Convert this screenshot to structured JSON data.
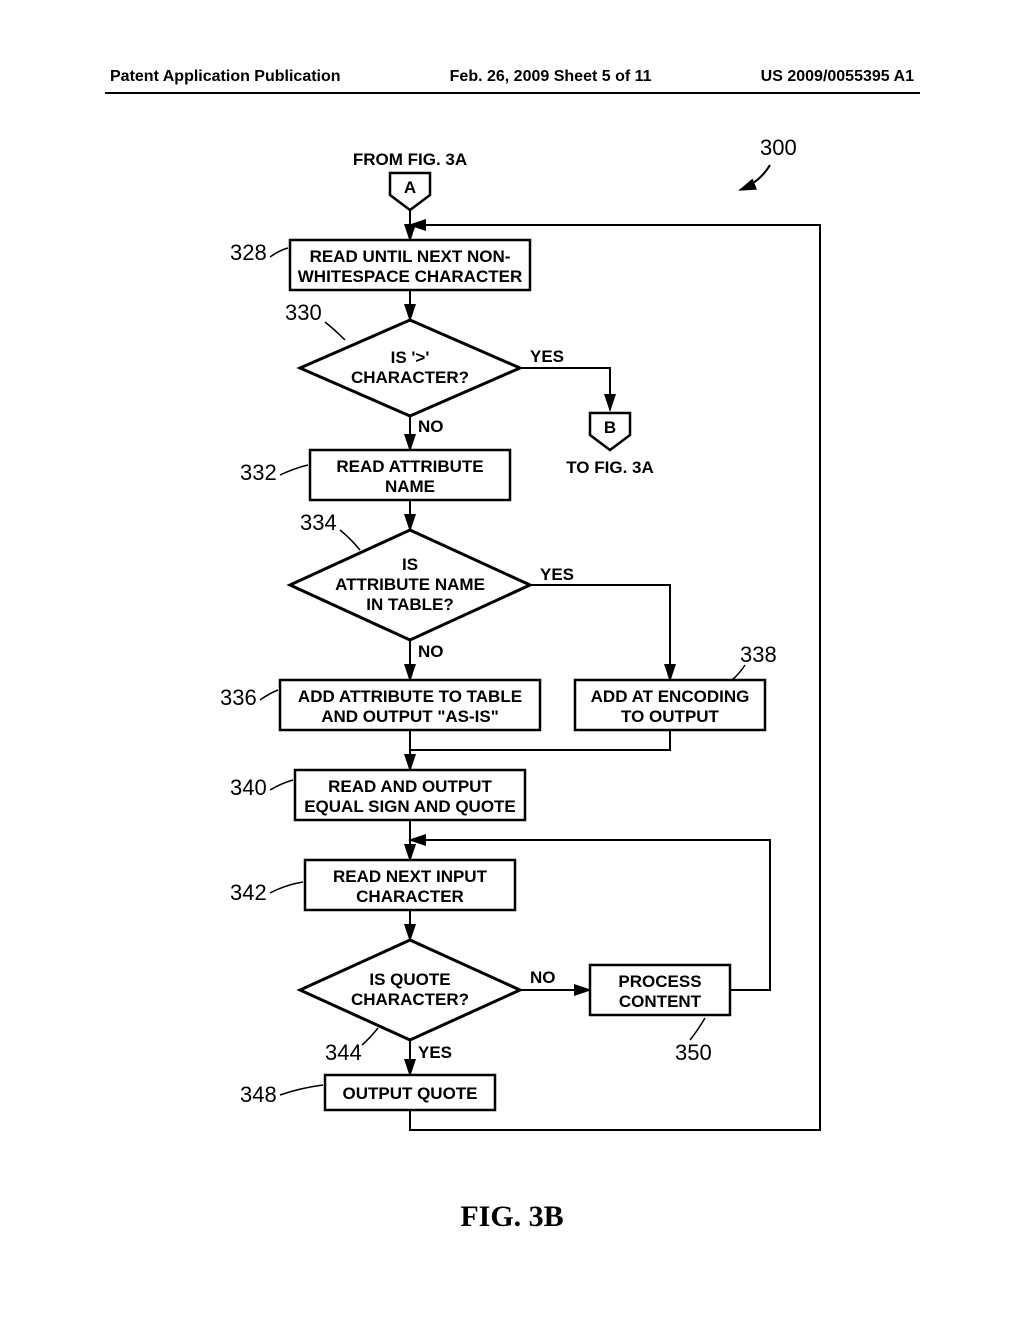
{
  "header": {
    "left": "Patent Application Publication",
    "center": "Feb. 26, 2009 Sheet 5 of 11",
    "right": "US 2009/0055395 A1"
  },
  "figure": {
    "title": "FIG. 3B",
    "overall_ref": "300",
    "from_label": "FROM FIG. 3A",
    "to_label": "TO FIG. 3A",
    "connector_a": "A",
    "connector_b": "B",
    "yes": "YES",
    "no": "NO",
    "steps": {
      "s328": {
        "ref": "328",
        "text1": "READ UNTIL NEXT NON-",
        "text2": "WHITESPACE CHARACTER"
      },
      "s330": {
        "ref": "330",
        "text1": "IS '>'",
        "text2": "CHARACTER?"
      },
      "s332": {
        "ref": "332",
        "text1": "READ ATTRIBUTE",
        "text2": "NAME"
      },
      "s334": {
        "ref": "334",
        "text1": "IS",
        "text2": "ATTRIBUTE NAME",
        "text3": "IN TABLE?"
      },
      "s336": {
        "ref": "336",
        "text1": "ADD ATTRIBUTE TO TABLE",
        "text2": "AND OUTPUT \"AS-IS\""
      },
      "s338": {
        "ref": "338",
        "text1": "ADD AT ENCODING",
        "text2": "TO OUTPUT"
      },
      "s340": {
        "ref": "340",
        "text1": "READ AND OUTPUT",
        "text2": "EQUAL SIGN AND QUOTE"
      },
      "s342": {
        "ref": "342",
        "text1": "READ NEXT INPUT",
        "text2": "CHARACTER"
      },
      "s344": {
        "ref": "344",
        "text1": "IS QUOTE",
        "text2": "CHARACTER?"
      },
      "s348": {
        "ref": "348",
        "text": "OUTPUT QUOTE"
      },
      "s350": {
        "ref": "350",
        "text1": "PROCESS",
        "text2": "CONTENT"
      }
    }
  }
}
